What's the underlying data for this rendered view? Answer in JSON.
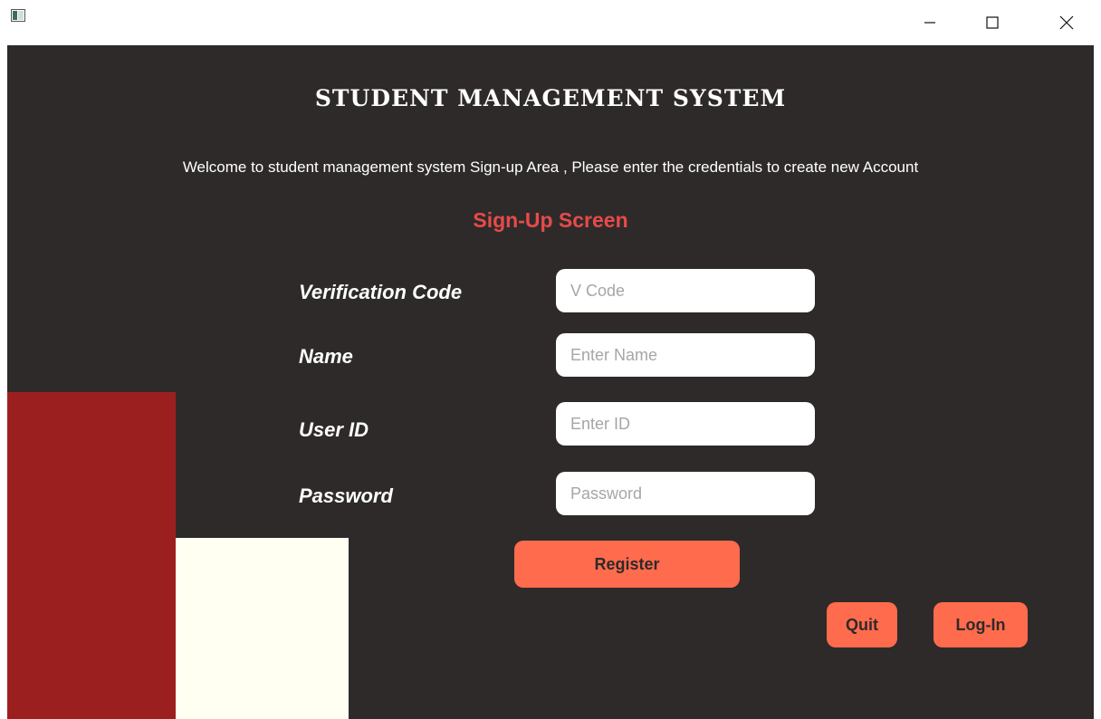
{
  "window": {
    "controls": {
      "minimize_icon": "minimize-icon",
      "maximize_icon": "maximize-icon",
      "close_icon": "close-icon"
    }
  },
  "header": {
    "title": "STUDENT MANAGEMENT SYSTEM",
    "welcome": "Welcome to student management system Sign-up Area , Please enter the credentials to create new Account",
    "subtitle": "Sign-Up Screen"
  },
  "form": {
    "fields": [
      {
        "label": "Verification Code",
        "placeholder": "V Code",
        "value": ""
      },
      {
        "label": "Name",
        "placeholder": "Enter Name",
        "value": ""
      },
      {
        "label": "User ID",
        "placeholder": "Enter ID",
        "value": ""
      },
      {
        "label": "Password",
        "placeholder": "Password",
        "value": ""
      }
    ],
    "register_label": "Register"
  },
  "actions": {
    "quit_label": "Quit",
    "login_label": "Log-In"
  },
  "colors": {
    "background": "#2e2a2a",
    "accent_button": "#ff6b4d",
    "subtitle_red": "#e84a4a",
    "deco_red": "#9c1f1f",
    "deco_cream": "#fffff2"
  }
}
